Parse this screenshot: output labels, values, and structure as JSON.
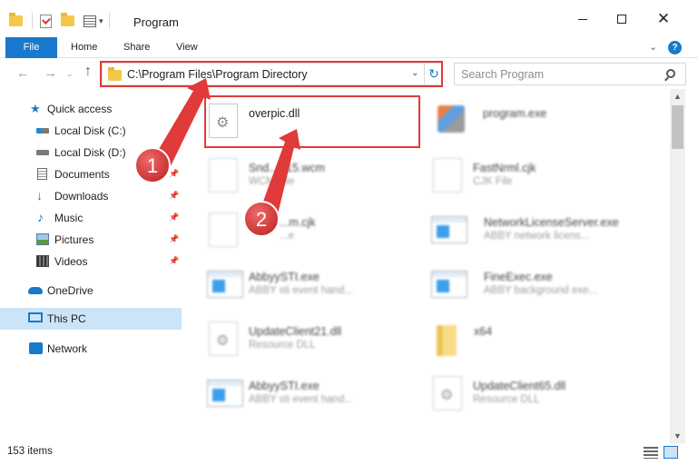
{
  "window": {
    "title": "Program",
    "controls": {
      "minimize": "",
      "maximize": "",
      "close": "✕"
    }
  },
  "ribbon": {
    "tabs": [
      "File",
      "Home",
      "Share",
      "View"
    ],
    "help": "?"
  },
  "address_bar": {
    "path": "C:\\Program Files\\Program Directory",
    "dropdown_glyph": "⌄",
    "refresh_glyph": "↻"
  },
  "search": {
    "placeholder": "Search Program"
  },
  "sidebar": {
    "items": [
      {
        "label": "Quick access",
        "icon": "star-icon",
        "pinned": false
      },
      {
        "label": "Local Disk (C:)",
        "icon": "drive-icon",
        "pinned": false
      },
      {
        "label": "Local Disk (D:)",
        "icon": "drive-icon",
        "pinned": true
      },
      {
        "label": "Documents",
        "icon": "documents-icon",
        "pinned": true
      },
      {
        "label": "Downloads",
        "icon": "download-icon",
        "pinned": true
      },
      {
        "label": "Music",
        "icon": "music-icon",
        "pinned": true
      },
      {
        "label": "Pictures",
        "icon": "pictures-icon",
        "pinned": true
      },
      {
        "label": "Videos",
        "icon": "videos-icon",
        "pinned": true
      },
      {
        "label": "OneDrive",
        "icon": "cloud-icon",
        "pinned": false
      },
      {
        "label": "This PC",
        "icon": "pc-icon",
        "pinned": false,
        "selected": true
      },
      {
        "label": "Network",
        "icon": "network-icon",
        "pinned": false
      }
    ]
  },
  "files": [
    {
      "name": "overpic.dll",
      "type": "",
      "icon": "dll-gear-icon",
      "highlighted": true
    },
    {
      "name": "program.exe",
      "type": "",
      "icon": "exe-icon"
    },
    {
      "name": "Snd...P15.wcm",
      "type": "WCM File",
      "icon": "blank-file-icon"
    },
    {
      "name": "FastNrml.cjk",
      "type": "CJK File",
      "icon": "blank-file-icon"
    },
    {
      "name": "...m.cjk",
      "type": "...e",
      "icon": "blank-file-icon"
    },
    {
      "name": "NetworkLicenseServer.exe",
      "type": "ABBY network licens...",
      "icon": "app-icon"
    },
    {
      "name": "AbbyySTI.exe",
      "type": "ABBY sti event hand...",
      "icon": "app-icon"
    },
    {
      "name": "FineExec.exe",
      "type": "ABBY background exe...",
      "icon": "app-icon"
    },
    {
      "name": "UpdateClient21.dll",
      "type": "Resource DLL",
      "icon": "dll-gear-icon"
    },
    {
      "name": "x64",
      "type": "",
      "icon": "folder-icon"
    },
    {
      "name": "AbbyySTI.exe",
      "type": "ABBY sti event hand...",
      "icon": "app-icon"
    },
    {
      "name": "UpdateClient65.dll",
      "type": "Resource DLL",
      "icon": "dll-gear-icon"
    }
  ],
  "status": {
    "item_count": "153 items"
  },
  "annotations": {
    "step1": "1",
    "step2": "2",
    "accent": "#e03a3a"
  },
  "colors": {
    "accent": "#1979ca",
    "selection": "#cce4f7",
    "annotation_red": "#e03a3a"
  }
}
